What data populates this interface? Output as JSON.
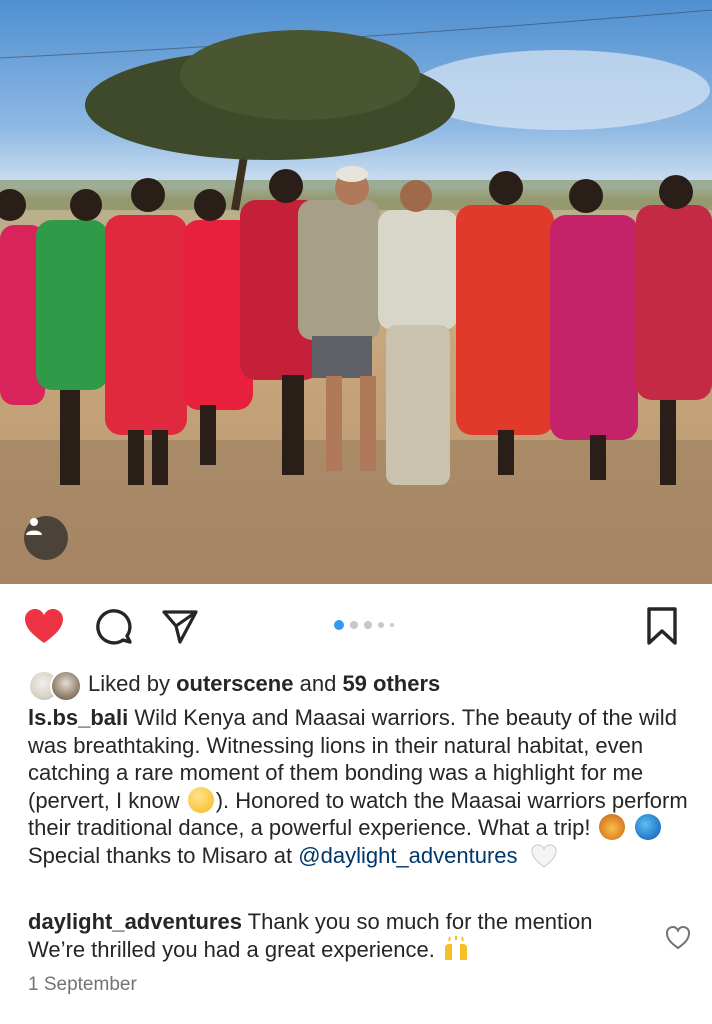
{
  "post": {
    "photo_alt": "photo",
    "carousel": {
      "total": 5,
      "active_index": 0
    },
    "liked": true
  },
  "icons": {
    "tag": "person-tag-icon",
    "like": "heart-filled-icon",
    "comment": "comment-icon",
    "share": "paper-plane-icon",
    "save": "bookmark-icon",
    "comment_like": "heart-outline-icon"
  },
  "colors": {
    "like_red": "#ed3344",
    "dot_active": "#3897f0",
    "mention_blue": "#00376b",
    "meta_gray": "#737373"
  },
  "likes": {
    "prefix": "Liked by",
    "user": "outerscene",
    "conjunction": "and",
    "others": "59 others"
  },
  "caption": {
    "username": "ls.bs_bali",
    "text_1": "Wild Kenya and Maasai warriors. The beauty of the wild was breathtaking. Witnessing lions in their natural habitat, even catching a rare moment of them bonding was a highlight for me (pervert, I know",
    "text_2": "). Honored to watch the Maasai warriors perform their traditional dance, a powerful experience. What a trip!",
    "text_3": "Special thanks to Misaro at",
    "mention": "@daylight_adventures"
  },
  "comment": {
    "username": "daylight_adventures",
    "text": "Thank you so much for the mention  We’re thrilled you had a great experience."
  },
  "date": "1 September"
}
